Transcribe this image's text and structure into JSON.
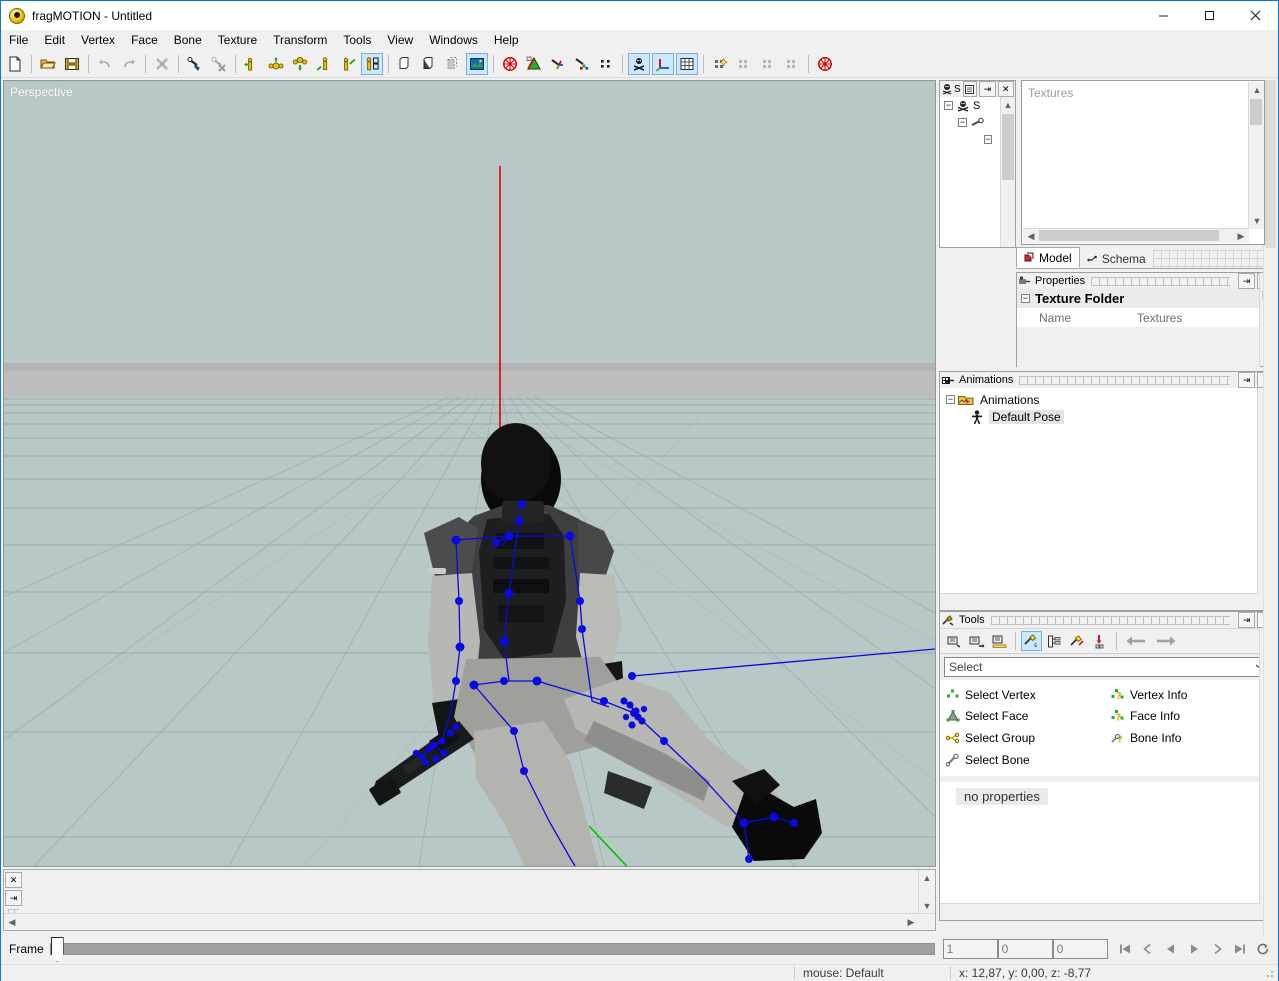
{
  "window": {
    "title": "fragMOTION - Untitled",
    "app_icon": "fragmotion-logo-icon",
    "minimize_label": "–",
    "maximize_label": "□",
    "close_label": "✕"
  },
  "menubar": {
    "items": [
      {
        "label": "File"
      },
      {
        "label": "Edit"
      },
      {
        "label": "Vertex"
      },
      {
        "label": "Face"
      },
      {
        "label": "Bone"
      },
      {
        "label": "Texture"
      },
      {
        "label": "Transform"
      },
      {
        "label": "Tools"
      },
      {
        "label": "View"
      },
      {
        "label": "Windows"
      },
      {
        "label": "Help"
      }
    ]
  },
  "toolbar": {
    "buttons": [
      {
        "name": "new-file-icon",
        "group": 0,
        "active": false
      },
      {
        "name": "open-file-icon",
        "group": 1,
        "active": false
      },
      {
        "name": "save-file-icon",
        "group": 1,
        "active": false
      },
      {
        "name": "undo-icon",
        "group": 2,
        "active": false
      },
      {
        "name": "redo-icon",
        "group": 2,
        "active": false
      },
      {
        "name": "delete-icon",
        "group": 3,
        "active": false
      },
      {
        "name": "select-bone-icon",
        "group": 4,
        "active": false
      },
      {
        "name": "deselect-bone-icon",
        "group": 4,
        "active": false
      },
      {
        "name": "move-figure-left-icon",
        "group": 5,
        "active": false
      },
      {
        "name": "rotate-figure-icon",
        "group": 5,
        "active": false
      },
      {
        "name": "scale-figure-icon",
        "group": 5,
        "active": false
      },
      {
        "name": "figure-origin-icon",
        "group": 5,
        "active": false
      },
      {
        "name": "figure-direction-icon",
        "group": 5,
        "active": false
      },
      {
        "name": "figure-frames-icon",
        "group": 5,
        "active": true
      },
      {
        "name": "copy-icon",
        "group": 6,
        "active": false
      },
      {
        "name": "paste-icon",
        "group": 6,
        "active": false
      },
      {
        "name": "duplicate-icon",
        "group": 6,
        "active": false
      },
      {
        "name": "texture-view-icon",
        "group": 6,
        "active": true
      },
      {
        "name": "wireframe-icon",
        "group": 7,
        "active": false
      },
      {
        "name": "flat-shaded-icon",
        "group": 7,
        "active": false
      },
      {
        "name": "smooth-shaded-icon",
        "group": 7,
        "active": false
      },
      {
        "name": "textured-icon",
        "group": 7,
        "active": false
      },
      {
        "name": "vertices-icon",
        "group": 7,
        "active": false
      },
      {
        "name": "show-skeleton-icon",
        "group": 8,
        "active": true
      },
      {
        "name": "show-axis-icon",
        "group": 8,
        "active": true
      },
      {
        "name": "show-grid-icon",
        "group": 8,
        "active": true
      },
      {
        "name": "mesh-tool-1-icon",
        "group": 9,
        "active": false
      },
      {
        "name": "mesh-tool-2-icon",
        "group": 9,
        "active": false
      },
      {
        "name": "mesh-tool-3-icon",
        "group": 9,
        "active": false
      },
      {
        "name": "mesh-tool-4-icon",
        "group": 9,
        "active": false
      },
      {
        "name": "render-wheel-icon",
        "group": 10,
        "active": false
      }
    ]
  },
  "viewport": {
    "label": "Perspective",
    "background_color": "#b8c8c6",
    "ground_color": "#bcbcbc",
    "skeleton_color": "#0000ff",
    "axis_x_color": "#00b000",
    "axis_y_color": "#ff0000",
    "axis_z_color": "#0000ff"
  },
  "model_panel": {
    "title": "",
    "toolbar_icons": [
      "model-tree-icon",
      "schema-icon",
      "list-icon"
    ],
    "pin_label": "⇥",
    "close_label": "✕",
    "tree": [
      {
        "label": "S",
        "icon": "skeleton-root-icon",
        "indent": 0,
        "expanded": true
      },
      {
        "label": "",
        "icon": "bone-icon",
        "indent": 1,
        "expanded": true
      },
      {
        "label": "",
        "icon": "child-node-icon",
        "indent": 2,
        "expanded": true
      }
    ],
    "tabs": [
      {
        "label": "Model",
        "icon": "model-tab-icon",
        "active": true
      },
      {
        "label": "Schema",
        "icon": "schema-tab-icon",
        "active": false
      }
    ]
  },
  "textures_window": {
    "placeholder": "Textures"
  },
  "properties_panel": {
    "title": "Properties",
    "icon": "properties-icon",
    "pin_label": "⇥",
    "close_label": "✕",
    "group_label": "Texture Folder",
    "rows": [
      {
        "name": "Name",
        "value": "Textures"
      }
    ]
  },
  "animations_panel": {
    "title": "Animations",
    "icon": "animations-icon",
    "pin_label": "⇥",
    "close_label": "✕",
    "tree": [
      {
        "label": "Animations",
        "icon": "animations-folder-icon",
        "indent": 0,
        "expanded": true,
        "selected": false
      },
      {
        "label": "Default Pose",
        "icon": "pose-figure-icon",
        "indent": 1,
        "expanded": false,
        "selected": true
      }
    ]
  },
  "tools_panel": {
    "title": "Tools",
    "icon": "tools-icon",
    "pin_label": "⇥",
    "close_label": "✕",
    "toolbar": [
      {
        "name": "tool-group-1-icon",
        "active": false
      },
      {
        "name": "tool-group-2-icon",
        "active": false
      },
      {
        "name": "tool-group-measure-icon",
        "active": false
      },
      {
        "name": "tool-select-icon",
        "active": true
      },
      {
        "name": "tool-hierarchy-icon",
        "active": false
      },
      {
        "name": "tool-modify-icon",
        "active": false
      },
      {
        "name": "tool-insert-icon",
        "active": false
      },
      {
        "name": "nav-back-icon",
        "active": false
      },
      {
        "name": "nav-forward-icon",
        "active": false
      }
    ],
    "selected_category": "Select",
    "items": [
      {
        "label": "Select Vertex",
        "icon": "select-vertex-icon"
      },
      {
        "label": "Vertex Info",
        "icon": "vertex-info-icon"
      },
      {
        "label": "Select Face",
        "icon": "select-face-icon"
      },
      {
        "label": "Face Info",
        "icon": "face-info-icon"
      },
      {
        "label": "Select Group",
        "icon": "select-group-icon"
      },
      {
        "label": "Bone Info",
        "icon": "bone-info-icon"
      },
      {
        "label": "Select Bone",
        "icon": "select-bone-tool-icon"
      }
    ],
    "properties_text": "no properties"
  },
  "bottom_panel": {
    "close_label": "✕",
    "pin_label": "⇥"
  },
  "framebar": {
    "label": "Frame",
    "slider_value": 0,
    "fields": [
      {
        "name": "frame-current",
        "value": "1"
      },
      {
        "name": "frame-start",
        "value": "0"
      },
      {
        "name": "frame-end",
        "value": "0"
      }
    ],
    "transport": [
      {
        "name": "go-to-start-button",
        "glyph": "⏮"
      },
      {
        "name": "previous-keyframe-button",
        "glyph": "‹"
      },
      {
        "name": "step-back-button",
        "glyph": "◀"
      },
      {
        "name": "play-button",
        "glyph": "▶"
      },
      {
        "name": "step-forward-button",
        "glyph": "›"
      },
      {
        "name": "go-to-end-button",
        "glyph": "⏭"
      },
      {
        "name": "loop-button",
        "glyph": "↻"
      }
    ]
  },
  "statusbar": {
    "mouse": "mouse: Default",
    "coordinates": "x: 12,87, y: 0,00, z: -8,77"
  }
}
